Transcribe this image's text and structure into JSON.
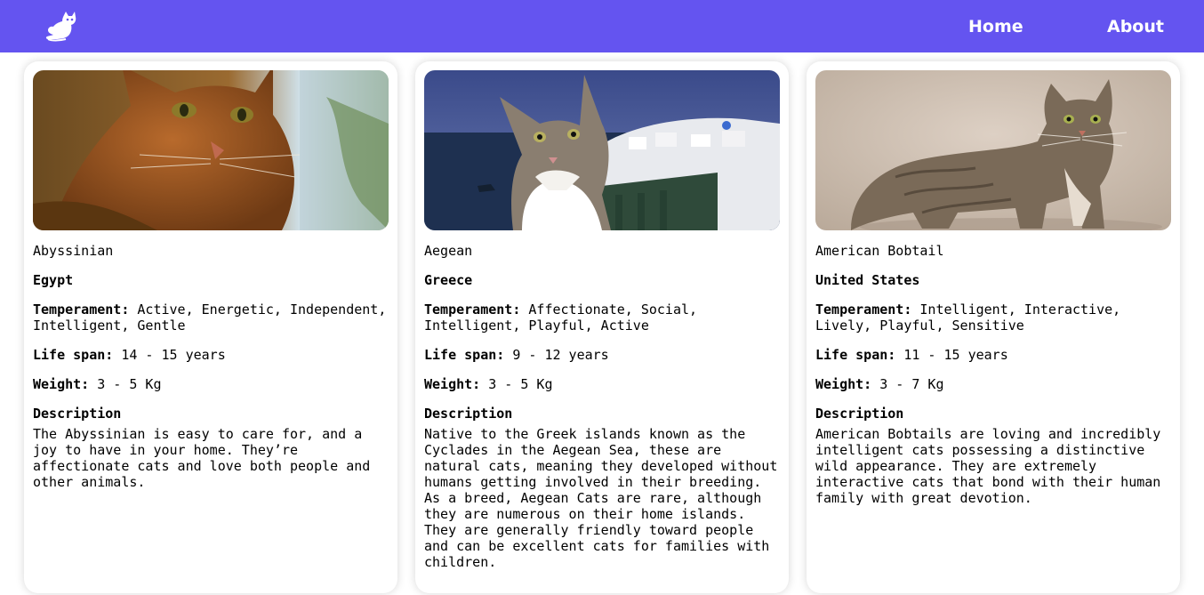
{
  "navbar": {
    "logo_icon": "cat-logo-icon",
    "background_color": "#6454f0",
    "links": [
      {
        "label": "Home"
      },
      {
        "label": "About"
      }
    ]
  },
  "cards": [
    {
      "image_icon": "abyssinian-cat-photo",
      "breed": "Abyssinian",
      "origin": "Egypt",
      "temperament_label": "Temperament:",
      "temperament": "Active, Energetic, Independent, Intelligent, Gentle",
      "life_span_label": "Life span:",
      "life_span": "14 - 15 years",
      "weight_label": "Weight:",
      "weight": "3 - 5 Kg",
      "description_label": "Description",
      "description": "The Abyssinian is easy to care for, and a joy to have in your home. They’re affectionate cats and love both people and other animals."
    },
    {
      "image_icon": "aegean-cat-photo",
      "breed": "Aegean",
      "origin": "Greece",
      "temperament_label": "Temperament:",
      "temperament": "Affectionate, Social, Intelligent, Playful, Active",
      "life_span_label": "Life span:",
      "life_span": "9 - 12 years",
      "weight_label": "Weight:",
      "weight": "3 - 5 Kg",
      "description_label": "Description",
      "description": "Native to the Greek islands known as the Cyclades in the Aegean Sea, these are natural cats, meaning they developed without humans getting involved in their breeding. As a breed, Aegean Cats are rare, although they are numerous on their home islands. They are generally friendly toward people and can be excellent cats for families with children."
    },
    {
      "image_icon": "american-bobtail-cat-photo",
      "breed": "American Bobtail",
      "origin": "United States",
      "temperament_label": "Temperament:",
      "temperament": "Intelligent, Interactive, Lively, Playful, Sensitive",
      "life_span_label": "Life span:",
      "life_span": "11 - 15 years",
      "weight_label": "Weight:",
      "weight": "3 - 7 Kg",
      "description_label": "Description",
      "description": "American Bobtails are loving and incredibly intelligent cats possessing a distinctive wild appearance. They are extremely interactive cats that bond with their human family with great devotion."
    }
  ]
}
